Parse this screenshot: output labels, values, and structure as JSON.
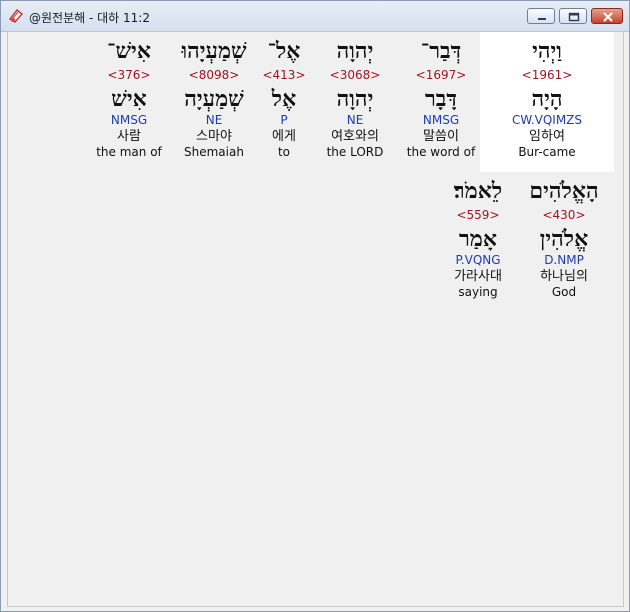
{
  "window": {
    "title": "@원전분해 - 대하 11:2"
  },
  "icons": {
    "app": "bible-app-icon",
    "minimize": "minimize-icon",
    "maximize": "maximize-icon",
    "close": "close-icon"
  },
  "colors": {
    "strong": "#a0141e",
    "parse": "#1f3bb0",
    "highlight": "#ffffff"
  },
  "rows": [
    {
      "words": [
        {
          "heb": "וַיְהִי",
          "strong": "<1961>",
          "lemma": "הָיָה",
          "parse": "CW.VQIMZS",
          "kor": "임하여",
          "eng": "Bur-came",
          "highlighted": true
        },
        {
          "heb": "דְּבַר־",
          "strong": "<1697>",
          "lemma": "דָּבָר",
          "parse": "NMSG",
          "kor": "말씀이",
          "eng": "the word of"
        },
        {
          "heb": "יְהוָה",
          "strong": "<3068>",
          "lemma": "יְהוָה",
          "parse": "NE",
          "kor": "여호와의",
          "eng": "the LORD"
        },
        {
          "heb": "אֶל־",
          "strong": "<413>",
          "lemma": "אֶל",
          "parse": "P",
          "kor": "에게",
          "eng": "to"
        },
        {
          "heb": "שְׁמַעְיָהוּ",
          "strong": "<8098>",
          "lemma": "שְׁמַעְיָה",
          "parse": "NE",
          "kor": "스마야",
          "eng": "Shemaiah"
        },
        {
          "heb": "אִישׁ־",
          "strong": "<376>",
          "lemma": "אִישׁ",
          "parse": "NMSG",
          "kor": "사람",
          "eng": "the man of"
        }
      ]
    },
    {
      "words": [
        {
          "heb": "הָאֱלֹהִים",
          "strong": "<430>",
          "lemma": "אֱלֹהִין",
          "parse": "D.NMP",
          "kor": "하나님의",
          "eng": "God"
        },
        {
          "heb": "לֵאמֹר׃",
          "strong": "<559>",
          "lemma": "אָמַר",
          "parse": "P.VQNG",
          "kor": "가라사대",
          "eng": "saying"
        }
      ]
    }
  ]
}
